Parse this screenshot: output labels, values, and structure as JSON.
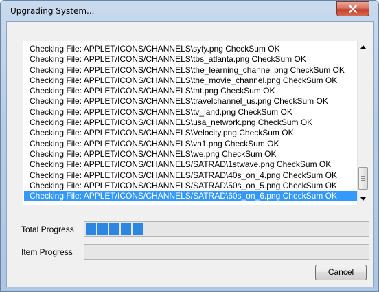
{
  "window": {
    "title": "Upgrading System...",
    "close_glyph": "x"
  },
  "log": {
    "rows": [
      "Checking File: APPLET/ICONS/CHANNELS\\syfy.png  CheckSum OK",
      "Checking File: APPLET/ICONS/CHANNELS\\tbs_atlanta.png  CheckSum OK",
      "Checking File: APPLET/ICONS/CHANNELS\\the_learning_channel.png  CheckSum OK",
      "Checking File: APPLET/ICONS/CHANNELS\\the_movie_channel.png  CheckSum OK",
      "Checking File: APPLET/ICONS/CHANNELS\\tnt.png  CheckSum OK",
      "Checking File: APPLET/ICONS/CHANNELS\\travelchannel_us.png  CheckSum OK",
      "Checking File: APPLET/ICONS/CHANNELS\\tv_land.png  CheckSum OK",
      "Checking File: APPLET/ICONS/CHANNELS\\usa_network.png  CheckSum OK",
      "Checking File: APPLET/ICONS/CHANNELS\\Velocity.png  CheckSum OK",
      "Checking File: APPLET/ICONS/CHANNELS\\vh1.png  CheckSum OK",
      "Checking File: APPLET/ICONS/CHANNELS\\we.png  CheckSum OK",
      "Checking File: APPLET/ICONS/CHANNELS/SATRAD\\1stwave.png  CheckSum OK",
      "Checking File: APPLET/ICONS/CHANNELS/SATRAD\\40s_on_4.png  CheckSum OK",
      "Checking File: APPLET/ICONS/CHANNELS/SATRAD\\50s_on_5.png  CheckSum OK",
      "Checking File: APPLET/ICONS/CHANNELS/SATRAD\\60s_on_6.png  CheckSum OK"
    ],
    "selected_index": 14
  },
  "progress": {
    "total_label": "Total Progress",
    "total_blocks": 5,
    "item_label": "Item Progress",
    "item_blocks": 0
  },
  "buttons": {
    "cancel": "Cancel"
  },
  "colors": {
    "selection": "#3399ff",
    "progress_fill": "#2b87e0"
  },
  "icons": {
    "close": "close-icon",
    "scroll_up": "scroll-up-arrow-icon",
    "scroll_down": "scroll-down-arrow-icon"
  }
}
